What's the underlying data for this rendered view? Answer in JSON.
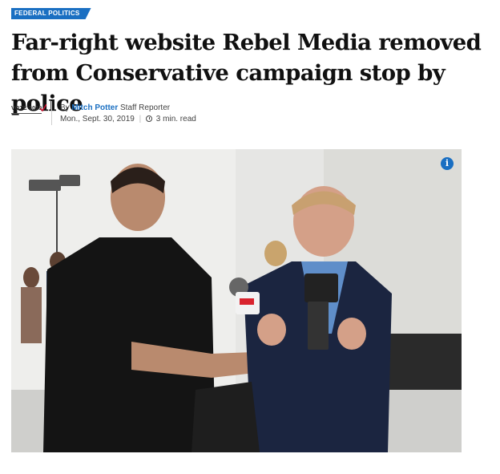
{
  "article": {
    "section_tag": "FEDERAL POLITICS",
    "headline": "Far-right website Rebel Media removed from Conservative campaign stop by police",
    "badge_text": "VOTE 2019",
    "by_prefix": "By",
    "author": "Mitch Potter",
    "author_role": "Staff Reporter",
    "date": "Mon., Sept. 30, 2019",
    "read_time": "3 min. read"
  },
  "photo": {
    "info_label": "i",
    "mic_flag_color": "#d9232e"
  },
  "colors": {
    "accent": "#1a6fc2",
    "headline": "#111111"
  }
}
